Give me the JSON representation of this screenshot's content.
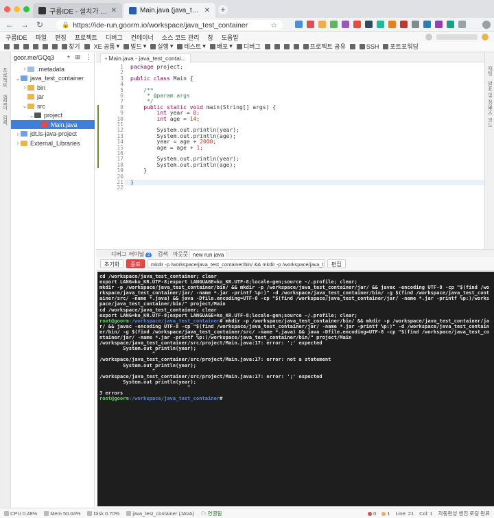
{
  "browser": {
    "tabs": [
      {
        "title": "구름IDE - 설치가 필요없는 통합개발환경 서비스",
        "active": false
      },
      {
        "title": "Main.java (java_test_container)",
        "active": true
      }
    ],
    "new_tab_glyph": "+",
    "url": "https://ide-run.goorm.io/workspace/java_test_container"
  },
  "menu": {
    "items": [
      "구름IDE",
      "파일",
      "편집",
      "프로젝트",
      "디버그",
      "컨테이너",
      "소스 코드 관리",
      "창",
      "도움말"
    ]
  },
  "toolbar": {
    "items": [
      "찾기",
      "XE 공통",
      "빌드",
      "실행",
      "테스트",
      "배포",
      "디버그",
      "프로젝트 공유",
      "SSH",
      "포트포워딩"
    ]
  },
  "left_strip": {
    "tabs": [
      "프로젝트",
      "앱얼이",
      "검색"
    ]
  },
  "right_strip": {
    "tabs": [
      "채팅",
      "발표 및 정보",
      "소스 코드"
    ]
  },
  "explorer": {
    "title": "goor.me/GQq3",
    "tree": [
      {
        "label": ".metadata",
        "depth": 1,
        "arrow": "›",
        "color": "#9fbfe8"
      },
      {
        "label": "java_test_container",
        "depth": 0,
        "arrow": "⌄",
        "color": "#6fa3e0"
      },
      {
        "label": "bin",
        "depth": 1,
        "arrow": "›",
        "color": "#e8b64c"
      },
      {
        "label": "jar",
        "depth": 1,
        "arrow": "",
        "color": "#e8b64c"
      },
      {
        "label": "src",
        "depth": 1,
        "arrow": "⌄",
        "color": "#e8b64c"
      },
      {
        "label": "project",
        "depth": 2,
        "arrow": "⌄",
        "color": "#555555"
      },
      {
        "label": "Main.java",
        "depth": 3,
        "arrow": "",
        "color": "#e34b4b"
      },
      {
        "label": "jdt.ls-java-project",
        "depth": 0,
        "arrow": "›",
        "color": "#6fa3e0"
      },
      {
        "label": "External_Libraries",
        "depth": 0,
        "arrow": "›",
        "color": "#e8b64c"
      }
    ],
    "selected_index": 6
  },
  "editor": {
    "tab_label": "Main.java - java_test_contai...",
    "current_line": 21,
    "line_numbers": [
      "1",
      "2",
      "3",
      "4",
      "5",
      "6",
      "7",
      "8",
      "9",
      "10",
      "11",
      "12",
      "13",
      "14",
      "15",
      "16",
      "17",
      "18",
      "19",
      "20",
      "21",
      "22"
    ],
    "lines": [
      "package project;",
      "",
      "public class Main {",
      "",
      "    /**",
      "     * @param args",
      "     */",
      "    public static void main(String[] args) {",
      "        int year = 0;",
      "        int age = 14;",
      "",
      "        System.out.println(year);",
      "        System.out.println(age);",
      "        year = age + 2000;",
      "        age = age + 1;",
      "",
      "        System.out.println(year);",
      "        System.out.println(age);",
      "    }",
      "",
      "}",
      ""
    ]
  },
  "bottom_panel": {
    "tabs": [
      "디버그",
      "터미널",
      "검색",
      "아웃풋",
      "new run java"
    ],
    "terminal_badge": "2",
    "active_tab": "new run java",
    "clear_button": "초기화",
    "stop_button": "종료",
    "command": "mkdir -p /workspace/java_test_container/bin/ && mkdir -p /workspace/java_test_container/jar/ && javac -encoding UTF-8",
    "edit_button": "편집"
  },
  "terminal": {
    "lines": [
      {
        "type": "plain",
        "text": "cd /workspace/java_test_container; clear"
      },
      {
        "type": "plain",
        "text": "export LANG=ko_KR.UTF-8;export LANGUAGE=ko_KR.UTF-8;locale-gen;source ~/.profile; clear;"
      },
      {
        "type": "plain",
        "text": "mkdir -p /workspace/java_test_container/bin/ && mkdir -p /workspace/java_test_container/jar/ && javac -encoding UTF-8 -cp \"$(find /workspace/java_test_container/jar/ -name *.jar -printf %p:)\" -d /workspace/java_test_container/bin/ -g $(find /workspace/java_test_container/src/ -name *.java) && java -Dfile.encoding=UTF-8 -cp \"$(find /workspace/java_test_container/jar/ -name *.jar -printf %p:)/workspace/java_test_container/bin/\" project/Main"
      },
      {
        "type": "plain",
        "text": "cd /workspace/java_test_container; clear"
      },
      {
        "type": "plain",
        "text": "export LANG=ko_KR.UTF-8;export LANGUAGE=ko_KR.UTF-8;locale-gen;source ~/.profile; clear;"
      },
      {
        "type": "prompt",
        "user": "root@goorm",
        "path": ":/workspace/java_test_container",
        "text": "# mkdir -p /workspace/java_test_container/bin/ && mkdir -p /workspace/java_test_container/jar/ && javac -encoding UTF-8 -cp \"$(find /workspace/java_test_container/jar/ -name *.jar -printf %p:)\" -d /workspace/java_test_container/bin/ -g $(find /workspace/java_test_container/src/ -name *.java) && java -Dfile.encoding=UTF-8 -cp \"$(find /workspace/java_test_container/jar/ -name *.jar -printf %p:)/workspace/java_test_container/bin/\" project/Main"
      },
      {
        "type": "plain",
        "text": "/workspace/java_test_container/src/project/Main.java:17: error: ';' expected"
      },
      {
        "type": "plain",
        "text": "        System.out println(year);"
      },
      {
        "type": "plain",
        "text": "                  ^"
      },
      {
        "type": "plain",
        "text": "/workspace/java_test_container/src/project/Main.java:17: error: not a statement"
      },
      {
        "type": "plain",
        "text": "        System.out println(year);"
      },
      {
        "type": "plain",
        "text": "                  ^"
      },
      {
        "type": "plain",
        "text": "/workspace/java_test_container/src/project/Main.java:17: error: ';' expected"
      },
      {
        "type": "plain",
        "text": "        System.out println(year);"
      },
      {
        "type": "plain",
        "text": "                              ^"
      },
      {
        "type": "plain",
        "text": "3 errors"
      },
      {
        "type": "prompt",
        "user": "root@goorm",
        "path": ":/workspace/java_test_container",
        "text": "#"
      }
    ]
  },
  "statusbar": {
    "cpu": "CPU 0.48%",
    "mem": "Mem 50.04%",
    "disk": "Disk 0.70%",
    "container": "java_test_container (JAVA)",
    "connection": "연결됨",
    "errors": "0",
    "warnings": "1",
    "line": "Line: 21",
    "col": "Col: 1",
    "status": "자동완성 엔진 로딩 완료"
  },
  "colors": {
    "accent": "#3f7fdc",
    "stop": "#e34b4b",
    "terminal_bg": "#1e1e1e",
    "prompt_user": "#5fd75f",
    "prompt_path": "#5f87d7"
  }
}
